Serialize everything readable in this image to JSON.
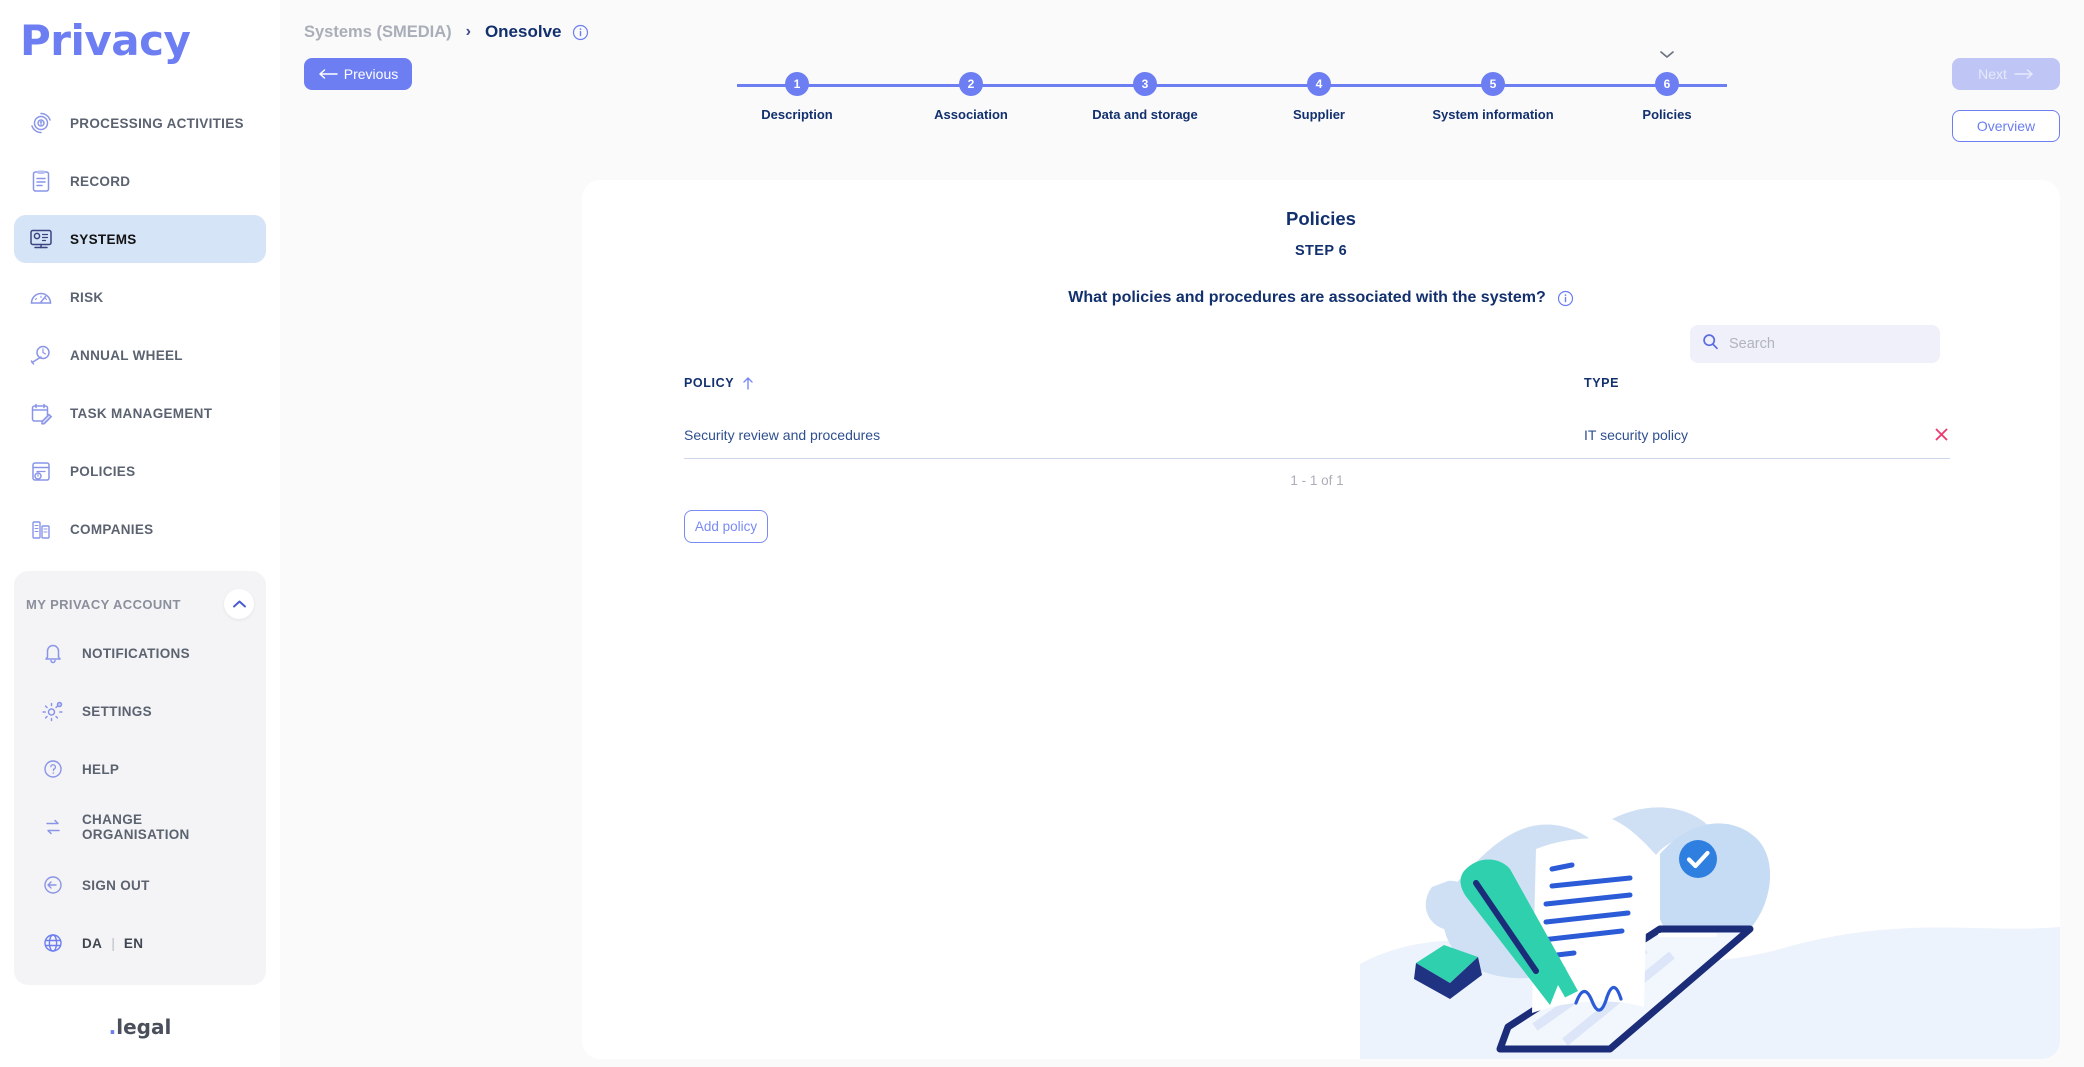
{
  "brand": {
    "name": "Privacy",
    "footer": ".legal",
    "footer_dot": ".",
    "footer_word": "legal"
  },
  "sidebar": {
    "items": [
      {
        "label": "PROCESSING ACTIVITIES",
        "icon": "processing-activities-icon",
        "active": false
      },
      {
        "label": "RECORD",
        "icon": "clipboard-icon",
        "active": false
      },
      {
        "label": "SYSTEMS",
        "icon": "systems-icon",
        "active": true
      },
      {
        "label": "RISK",
        "icon": "gauge-icon",
        "active": false
      },
      {
        "label": "ANNUAL WHEEL",
        "icon": "annual-wheel-icon",
        "active": false
      },
      {
        "label": "TASK MANAGEMENT",
        "icon": "task-management-icon",
        "active": false
      },
      {
        "label": "POLICIES",
        "icon": "policies-icon",
        "active": false
      },
      {
        "label": "COMPANIES",
        "icon": "companies-icon",
        "active": false
      }
    ],
    "account": {
      "title": "MY PRIVACY ACCOUNT",
      "collapse_icon": "chevron-up-icon",
      "items": [
        {
          "label": "NOTIFICATIONS",
          "icon": "bell-icon"
        },
        {
          "label": "SETTINGS",
          "icon": "gear-icon"
        },
        {
          "label": "HELP",
          "icon": "help-circle-icon"
        },
        {
          "label": "CHANGE ORGANISATION",
          "icon": "swap-icon"
        },
        {
          "label": "SIGN OUT",
          "icon": "sign-out-icon"
        }
      ],
      "language": {
        "icon": "globe-icon",
        "da": "DA",
        "separator": "|",
        "en": "EN"
      }
    }
  },
  "breadcrumb": {
    "parent": "Systems (SMEDIA)",
    "separator": "›",
    "current": "Onesolve",
    "info_icon": "info-icon"
  },
  "toolbar": {
    "previous_label": "Previous",
    "previous_icon": "arrow-left-icon",
    "next_label": "Next",
    "next_icon": "arrow-right-icon",
    "overview_label": "Overview"
  },
  "stepper": {
    "current": 6,
    "chevron_icon": "chevron-down-icon",
    "steps": [
      {
        "number": "1",
        "label": "Description"
      },
      {
        "number": "2",
        "label": "Association"
      },
      {
        "number": "3",
        "label": "Data and storage"
      },
      {
        "number": "4",
        "label": "Supplier"
      },
      {
        "number": "5",
        "label": "System information"
      },
      {
        "number": "6",
        "label": "Policies"
      }
    ]
  },
  "content": {
    "title": "Policies",
    "step_text": "STEP 6",
    "question": "What policies and procedures are associated with the system?",
    "question_info_icon": "info-icon",
    "search": {
      "placeholder": "Search",
      "value": "",
      "icon": "search-icon"
    },
    "table": {
      "columns": [
        {
          "key": "policy",
          "label": "POLICY",
          "sort_icon": "sort-asc-icon"
        },
        {
          "key": "type",
          "label": "TYPE",
          "sort_icon": ""
        }
      ],
      "rows": [
        {
          "policy": "Security review and procedures",
          "type": "IT security policy",
          "delete_icon": "close-x-icon"
        }
      ],
      "pager": "1 - 1 of 1"
    },
    "add_button": "Add policy",
    "illustration": "document-signing-illustration"
  },
  "colors": {
    "accent": "#6C7EF2",
    "dark_blue": "#12306E",
    "link_blue": "#2F4F8F",
    "delete_red": "#EE3A6E",
    "sidebar_active": "#D6E4F7",
    "page_bg": "#FAFAFA",
    "search_bg": "#EFF0FA",
    "teal": "#2FD0AD"
  }
}
